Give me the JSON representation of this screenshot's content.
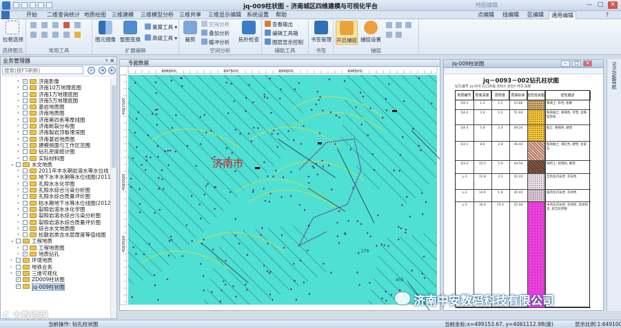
{
  "window": {
    "title": "jq-009柱状图 - 济南城区四维建模与可视化平台",
    "context_tab": "地图编辑",
    "min": "—",
    "max": "□",
    "close": "✕"
  },
  "menu_tabs": [
    "开始",
    "二维查询统计",
    "地质绘图",
    "三维建模",
    "三维模型分析",
    "三维共享",
    "三维显示编辑",
    "系统设置",
    "帮助"
  ],
  "right_tabs": [
    "点编辑",
    "线编辑",
    "区编辑",
    "通用编辑"
  ],
  "ribbon": {
    "groups": [
      {
        "label": "选择图元",
        "buttons": [
          "拉框选择"
        ]
      },
      {
        "label": "常用工具",
        "buttons": []
      },
      {
        "label": "扩展编辑",
        "buttons": [
          "图元镜像",
          "整图变换",
          "量算工具 ▾",
          "高级工具 ▾"
        ]
      },
      {
        "label": "空间分析",
        "buttons": [
          "裁剪",
          "空间分析",
          "叠加分析",
          "缓冲分析",
          "拓扑检查"
        ]
      },
      {
        "label": "辅助工具",
        "buttons": [
          "查看输出",
          "编辑工具箱",
          "图层显示控制"
        ]
      },
      {
        "label": "书签",
        "buttons": [
          "书签管理"
        ]
      },
      {
        "label": "捕捉",
        "buttons": [
          "开启捕捉",
          "捕捉设置"
        ]
      }
    ]
  },
  "panel": {
    "title": "业务管理器",
    "pin": "ᵖ ✕",
    "search_placeholder": "搜索(按F5刷新)",
    "tree": [
      {
        "indent": 2,
        "exp": "›",
        "checked": true,
        "label": "济南影像"
      },
      {
        "indent": 2,
        "exp": "›",
        "checked": false,
        "label": "济南10万地理底图"
      },
      {
        "indent": 2,
        "exp": "›",
        "checked": false,
        "label": "济南1万地理底图"
      },
      {
        "indent": 2,
        "exp": "›",
        "checked": false,
        "label": "济南5万地理底图"
      },
      {
        "indent": 2,
        "exp": "›",
        "checked": false,
        "label": "基岩地质图"
      },
      {
        "indent": 2,
        "exp": "›",
        "checked": false,
        "label": "济南地质图"
      },
      {
        "indent": 2,
        "exp": "›",
        "checked": false,
        "label": "济南第四系等厚线图"
      },
      {
        "indent": 2,
        "exp": "›",
        "checked": false,
        "label": "济南断裂分布图"
      },
      {
        "indent": 2,
        "exp": "›",
        "checked": false,
        "label": "济南製岩顶板埋深图"
      },
      {
        "indent": 2,
        "exp": "›",
        "checked": false,
        "label": "济南基岩地质图"
      },
      {
        "indent": 2,
        "exp": "›",
        "checked": false,
        "label": "建模侧面与工作区范围"
      },
      {
        "indent": 2,
        "exp": "›",
        "checked": false,
        "label": "钻孔密度统计图"
      },
      {
        "indent": 2,
        "exp": "›",
        "checked": false,
        "label": "实际材料图"
      },
      {
        "indent": 1,
        "exp": "⌄",
        "checked": false,
        "label": "水文地质"
      },
      {
        "indent": 2,
        "exp": "›",
        "checked": false,
        "label": "2011年丰水期岩溶水等水位线"
      },
      {
        "indent": 2,
        "exp": "›",
        "checked": false,
        "label": "地下水丰水期等水位线图(2011年)"
      },
      {
        "indent": 2,
        "exp": "›",
        "checked": false,
        "label": "孔隙水水化学图"
      },
      {
        "indent": 2,
        "exp": "›",
        "checked": false,
        "label": "孔隙水综合污染分析图"
      },
      {
        "indent": 2,
        "exp": "›",
        "checked": false,
        "label": "孔隙水综合质量评价图"
      },
      {
        "indent": 2,
        "exp": "›",
        "checked": false,
        "label": "枯水期地下水等水位线图(2012年)"
      },
      {
        "indent": 2,
        "exp": "›",
        "checked": false,
        "label": "裂隙岩溶水水化学图"
      },
      {
        "indent": 2,
        "exp": "›",
        "checked": false,
        "label": "裂隙岩溶水综合污染分析图"
      },
      {
        "indent": 2,
        "exp": "›",
        "checked": false,
        "label": "裂隙岩溶水综合质量评价图"
      },
      {
        "indent": 2,
        "exp": "›",
        "checked": false,
        "label": "综合水文地质图"
      },
      {
        "indent": 2,
        "exp": "›",
        "checked": false,
        "label": "松散岩类含水层厚度等值线图"
      },
      {
        "indent": 1,
        "exp": "⌄",
        "checked": false,
        "label": "工程地质"
      },
      {
        "indent": 2,
        "exp": "›",
        "checked": false,
        "label": "工程地质图"
      },
      {
        "indent": 2,
        "exp": "›",
        "checked": true,
        "label": "地质钻孔"
      },
      {
        "indent": 1,
        "exp": "›",
        "checked": false,
        "label": "环境地质"
      },
      {
        "indent": 1,
        "exp": "›",
        "checked": false,
        "label": "地铁业务"
      },
      {
        "indent": 1,
        "exp": "›",
        "checked": true,
        "label": "三维可视化"
      },
      {
        "indent": 1,
        "exp": "",
        "checked": true,
        "label": "ZD009柱状图"
      },
      {
        "indent": 1,
        "exp": "",
        "checked": true,
        "label": "jq-009柱状图",
        "selected": true
      }
    ]
  },
  "map": {
    "title": "专题数据",
    "city_label": "济南市",
    "x_ticks": [
      "498000",
      "497500",
      "499500",
      "498500"
    ],
    "y_ticks": [
      "4061500",
      "4060000",
      "4059500"
    ],
    "num_labels": [
      "279",
      "459"
    ],
    "hatch_color": "#1f3d54",
    "fill_color": "#4ee0d3",
    "dot_color": "#6b1b86"
  },
  "column": {
    "title": "jq-009柱状图",
    "sheet_title": "jq－0093－002钻孔柱状图",
    "subheader": "钻孔编号  jq-009   孔口高程   坐标X   坐标Y   终孔深度",
    "headers": [
      "地层编号",
      "层底深度",
      "层厚度",
      "层底标高",
      "岩性柱状图",
      "岩性描述"
    ],
    "layers": [
      {
        "code": "Q4-1",
        "depth": "1.2",
        "thick": "1.2",
        "elev": "53.86",
        "color": "#c9a46b",
        "pattern": "dots",
        "desc": "素填土: 杂色, 松散"
      },
      {
        "code": "Q4-2",
        "depth": "3.4",
        "thick": "2.2",
        "elev": "51.64",
        "color": "#f2c230",
        "pattern": "dots",
        "desc": "粉质黏土: 黄褐色, 可塑, 含铁锰结核"
      },
      {
        "code": "Q4-3",
        "depth": "5.8",
        "thick": "2.4",
        "elev": "49.24",
        "color": "#f2c230",
        "pattern": "dots",
        "desc": "黏土: 黄褐色, 硬塑"
      },
      {
        "code": "Q3-1",
        "depth": "8.6",
        "thick": "2.8",
        "elev": "46.44",
        "color": "#b0705a",
        "pattern": "hatch",
        "desc": "粉质黏土: 褐红色, 硬塑, 含姜石"
      },
      {
        "code": "Q3-2",
        "depth": "10.5",
        "thick": "1.9",
        "elev": "44.54",
        "color": "#8a5a48",
        "pattern": "cross",
        "desc": "残积土: 棕褐色, 硬塑"
      },
      {
        "code": "γ-1",
        "depth": "12.8",
        "thick": "2.3",
        "elev": "42.24",
        "color": "#ebe3ea",
        "pattern": "dots",
        "desc": "全风化闪长岩: 灰白色"
      },
      {
        "code": "γ-2",
        "depth": "14.6",
        "thick": "1.8",
        "elev": "40.44",
        "color": "#d8c9d6",
        "pattern": "dots",
        "desc": "强风化闪长岩: 灰绿色"
      },
      {
        "code": "γ-3",
        "depth": "30.0",
        "thick": "15.4",
        "elev": "25.04",
        "color": "#ee3fe0",
        "pattern": "plus",
        "desc": "中风化闪长岩: 灰绿色, 块状构造, 岩芯较完整"
      }
    ]
  },
  "right_sidebar": "GIS功能导航",
  "status": {
    "left": "当前操作: 钻孔柱状图",
    "coords": "当前坐标:x=499153.67, y=4061112.98(度)",
    "scale": "显示比例:1:649100"
  },
  "watermark": {
    "company": "济南中安数码科技有限公司",
    "badge": "C 大数跨境"
  }
}
